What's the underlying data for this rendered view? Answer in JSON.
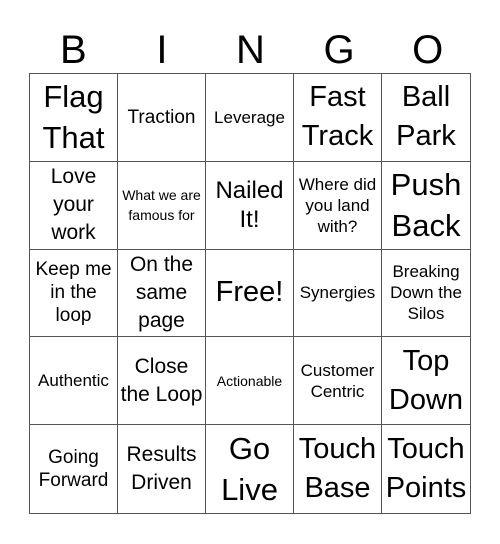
{
  "header": {
    "letters": [
      "B",
      "I",
      "N",
      "G",
      "O"
    ]
  },
  "cells": [
    "Flag That",
    "Traction",
    "Leverage",
    "Fast Track",
    "Ball Park",
    "Love your work",
    "What we are famous for",
    "Nailed It!",
    "Where did you land with?",
    "Push Back",
    "Keep me in the loop",
    "On the same page",
    "Free!",
    "Synergies",
    "Breaking Down the Silos",
    "Authentic",
    "Close the Loop",
    "Actionable",
    "Customer Centric",
    "Top Down",
    "Going Forward",
    "Results Driven",
    "Go Live",
    "Touch Base",
    "Touch Points"
  ]
}
